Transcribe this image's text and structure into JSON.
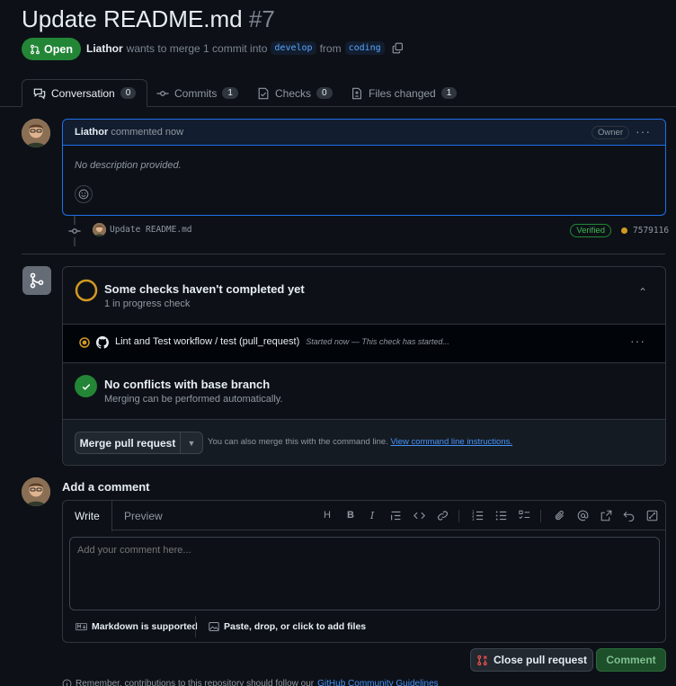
{
  "pr": {
    "title": "Update README.md",
    "number": "#7",
    "state": "Open",
    "author": "Liathor",
    "merge_text": "wants to merge 1 commit into",
    "base_branch": "develop",
    "from_text": "from",
    "head_branch": "coding"
  },
  "tabs": [
    {
      "label": "Conversation",
      "count": "0",
      "icon": "comment-discussion-icon"
    },
    {
      "label": "Commits",
      "count": "1",
      "icon": "git-commit-icon"
    },
    {
      "label": "Checks",
      "count": "0",
      "icon": "checklist-icon"
    },
    {
      "label": "Files changed",
      "count": "1",
      "icon": "file-diff-icon"
    }
  ],
  "comment": {
    "author": "Liathor",
    "time": "commented now",
    "role": "Owner",
    "body": "No description provided."
  },
  "commit": {
    "message": "Update README.md",
    "badge": "Verified",
    "sha": "7579116"
  },
  "checks": {
    "title": "Some checks haven't completed yet",
    "subtitle": "1 in progress check",
    "item_name": "Lint and Test workflow / test (pull_request)",
    "item_status": "Started now — This check has started...",
    "conflicts_title": "No conflicts with base branch",
    "conflicts_subtitle": "Merging can be performed automatically.",
    "merge_button": "Merge pull request",
    "also_text": "You can also merge this with the command line.",
    "cli_link": "View command line instructions."
  },
  "add_comment": {
    "heading": "Add a comment",
    "tab_write": "Write",
    "tab_preview": "Preview",
    "placeholder": "Add your comment here...",
    "markdown_note": "Markdown is supported",
    "attach_note": "Paste, drop, or click to add files",
    "toolbar": [
      "heading-icon",
      "bold-icon",
      "italic-icon",
      "quote-icon",
      "code-icon",
      "link-icon",
      "ordered-list-icon",
      "unordered-list-icon",
      "task-list-icon",
      "attach-icon",
      "mention-icon",
      "reference-icon",
      "undo-icon",
      "fullscreen-icon"
    ]
  },
  "actions": {
    "close_label": "Close pull request",
    "comment_label": "Comment"
  },
  "footer": {
    "text": "Remember, contributions to this repository should follow our",
    "link": "GitHub Community Guidelines"
  },
  "colors": {
    "accent_green": "#238636",
    "accent_blue": "#1f6feb",
    "pending": "#d29922",
    "danger": "#f85149"
  }
}
